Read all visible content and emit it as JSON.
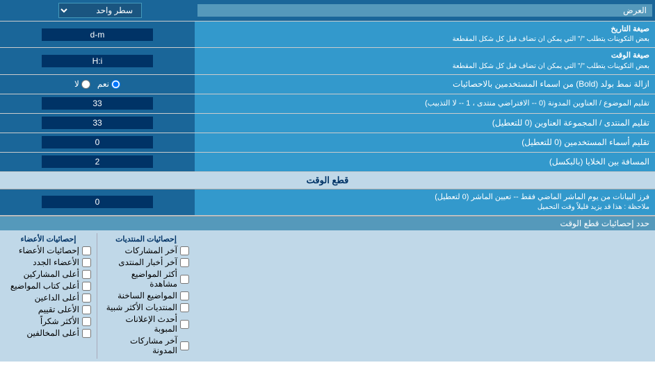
{
  "header": {
    "dropdown_label": "سطر واحد",
    "field_label": "العرض"
  },
  "rows": [
    {
      "id": "date_format",
      "label": "صيغة التاريخ",
      "sublabel": "بعض التكوينات يتطلب \"/\" التي يمكن ان تضاف قبل كل شكل المقطعة",
      "input_value": "d-m",
      "type": "text"
    },
    {
      "id": "time_format",
      "label": "صيغة الوقت",
      "sublabel": "بعض التكوينات يتطلب \"/\" التي يمكن ان تضاف قبل كل شكل المقطعة",
      "input_value": "H:i",
      "type": "text"
    },
    {
      "id": "bold_remove",
      "label": "ازالة نمط بولد (Bold) من اسماء المستخدمين بالاحصائيات",
      "type": "radio",
      "radio_options": [
        {
          "value": "yes",
          "label": "نعم",
          "checked": true
        },
        {
          "value": "no",
          "label": "لا",
          "checked": false
        }
      ]
    },
    {
      "id": "topic_header_limit",
      "label": "تقليم الموضوع / العناوين المدونة (0 -- الافتراضي منتدى ، 1 -- لا التذبيب)",
      "input_value": "33",
      "type": "text"
    },
    {
      "id": "forum_header_limit",
      "label": "تقليم المنتدى / المجموعة العناوين (0 للتعطيل)",
      "input_value": "33",
      "type": "text"
    },
    {
      "id": "username_limit",
      "label": "تقليم أسماء المستخدمين (0 للتعطيل)",
      "input_value": "0",
      "type": "text"
    },
    {
      "id": "cell_spacing",
      "label": "المسافة بين الخلايا (بالبكسل)",
      "input_value": "2",
      "type": "text"
    }
  ],
  "cutoff_section": {
    "title": "قطع الوقت",
    "row": {
      "id": "cutoff_time",
      "label": "فرز البيانات من يوم الماشر الماضي فقط -- تعيين الماشر (0 لتعطيل)",
      "sublabel": "ملاحظة : هذا قد يزيد قليلاً وقت التحميل",
      "input_value": "0",
      "type": "text"
    }
  },
  "stats_section": {
    "title": "حدد إحصائيات قطع الوقت",
    "col1_header": "",
    "col2_header": "إحصائيات المنتديات",
    "col3_header": "إحصائيات الأعضاء",
    "col2_items": [
      {
        "label": "آخر المشاركات",
        "checked": false
      },
      {
        "label": "آخر أخبار المنتدى",
        "checked": false
      },
      {
        "label": "أكثر المواضيع مشاهدة",
        "checked": false
      },
      {
        "label": "المواضيع الساخنة",
        "checked": false
      },
      {
        "label": "المنتديات الأكثر شبية",
        "checked": false
      },
      {
        "label": "أحدث الإعلانات المبوبة",
        "checked": false
      },
      {
        "label": "آخر مشاركات المدونة",
        "checked": false
      }
    ],
    "col3_items": [
      {
        "label": "إحصائيات الأعضاء",
        "checked": false
      },
      {
        "label": "الأعضاء الجدد",
        "checked": false
      },
      {
        "label": "أعلى المشاركين",
        "checked": false
      },
      {
        "label": "أعلى كتاب المواضيع",
        "checked": false
      },
      {
        "label": "أعلى الداعين",
        "checked": false
      },
      {
        "label": "الأعلى تقييم",
        "checked": false
      },
      {
        "label": "الأكثر شكراً",
        "checked": false
      },
      {
        "label": "أعلى المخالفين",
        "checked": false
      }
    ]
  }
}
